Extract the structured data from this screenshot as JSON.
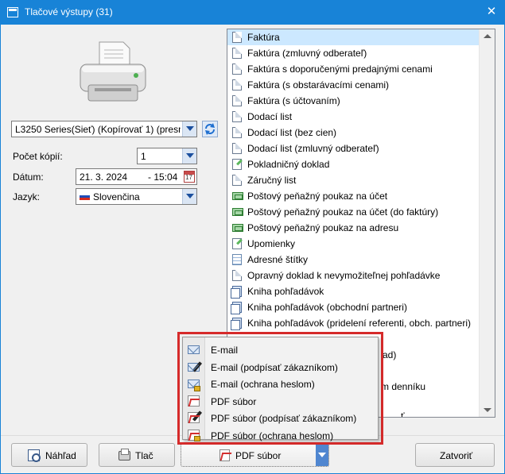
{
  "window": {
    "title": "Tlačové výstupy  (31)",
    "close_glyph": "✕"
  },
  "printer": {
    "value": "L3250 Series(Sieť) (Kopírovať 1) (presm"
  },
  "copies": {
    "label": "Počet kópií:",
    "value": "1"
  },
  "date": {
    "label": "Dátum:",
    "date": "21. 3. 2024",
    "time": "- 15:04"
  },
  "language": {
    "label": "Jazyk:",
    "value": "Slovenčina"
  },
  "reports": [
    {
      "label": "Faktúra",
      "icon": "document-icon",
      "selected": true
    },
    {
      "label": "Faktúra (zmluvný odberateľ)",
      "icon": "document-icon"
    },
    {
      "label": "Faktúra s doporučenými predajnými cenami",
      "icon": "document-icon"
    },
    {
      "label": "Faktúra (s obstarávacími cenami)",
      "icon": "document-icon"
    },
    {
      "label": "Faktúra (s účtovaním)",
      "icon": "document-icon"
    },
    {
      "label": "Dodací list",
      "icon": "document-icon"
    },
    {
      "label": "Dodací list (bez cien)",
      "icon": "document-icon"
    },
    {
      "label": "Dodací list (zmluvný odberateľ)",
      "icon": "document-icon"
    },
    {
      "label": "Pokladničný doklad",
      "icon": "receipt-icon"
    },
    {
      "label": "Záručný list",
      "icon": "document-icon"
    },
    {
      "label": "Poštový peňažný poukaz na účet",
      "icon": "money-order-icon"
    },
    {
      "label": "Poštový peňažný poukaz na účet (do faktúry)",
      "icon": "money-order-icon"
    },
    {
      "label": "Poštový peňažný poukaz na adresu",
      "icon": "money-order-icon"
    },
    {
      "label": "Upomienky",
      "icon": "receipt-icon"
    },
    {
      "label": "Adresné štítky",
      "icon": "labels-icon"
    },
    {
      "label": "Opravný doklad k nevymožiteľnej pohľadávke",
      "icon": "document-icon"
    },
    {
      "label": "Kniha pohľadávok",
      "icon": "book-icon"
    },
    {
      "label": "Kniha pohľadávok (obchodní partneri)",
      "icon": "book-icon"
    },
    {
      "label": "Kniha pohľadávok (pridelení referenti, obch. partneri)",
      "icon": "book-icon"
    }
  ],
  "partial_items": [
    "ad)",
    "m denníku",
    "ť"
  ],
  "export_menu": [
    {
      "label": "E-mail",
      "icon": "email-icon"
    },
    {
      "label": "E-mail (podpísať zákazníkom)",
      "icon": "email-sign-icon"
    },
    {
      "label": "E-mail (ochrana heslom)",
      "icon": "email-lock-icon"
    },
    {
      "label": "PDF súbor",
      "icon": "pdf-icon"
    },
    {
      "label": "PDF súbor (podpísať zákazníkom)",
      "icon": "pdf-sign-icon"
    },
    {
      "label": "PDF súbor (ochrana heslom)",
      "icon": "pdf-lock-icon"
    }
  ],
  "buttons": {
    "preview": "Náhľad",
    "print": "Tlač",
    "pdf": "PDF súbor",
    "close": "Zatvoriť"
  },
  "colors": {
    "titlebar": "#1883d7",
    "highlight_frame": "#d62b2b",
    "selection": "#cce8ff"
  }
}
